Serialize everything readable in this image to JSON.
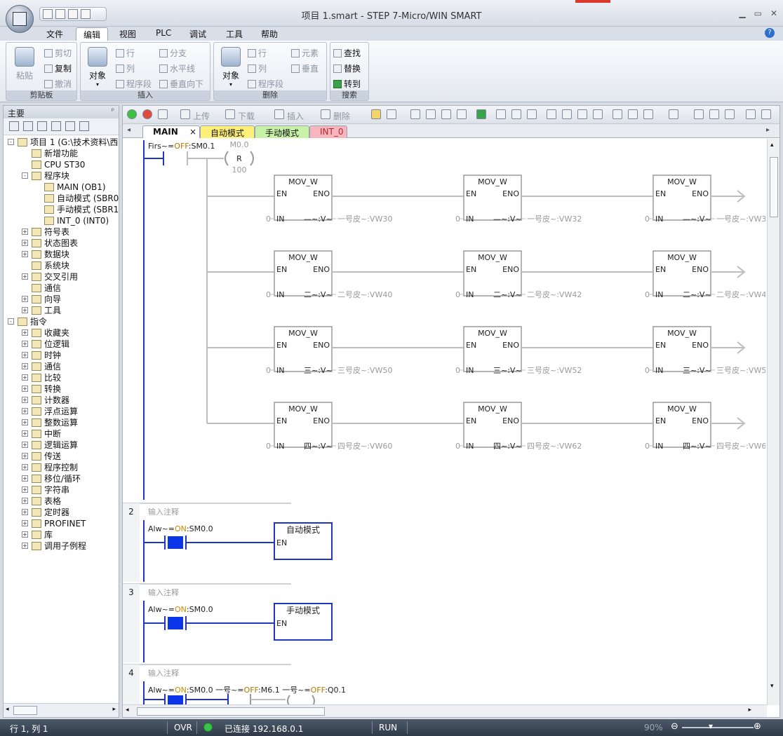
{
  "window": {
    "title": "项目 1.smart - STEP 7-Micro/WIN SMART"
  },
  "menu": [
    "文件",
    "编辑",
    "视图",
    "PLC",
    "调试",
    "工具",
    "帮助"
  ],
  "ribbon": {
    "clipboard": {
      "paste": "粘贴",
      "cut": "剪切",
      "copy": "复制",
      "undo": "撤消",
      "caption": "剪贴板"
    },
    "insert": {
      "object": "对象",
      "row": "行",
      "column": "列",
      "segment": "程序段",
      "branch": "分支",
      "horizontal": "水平线",
      "vertical_down": "垂直向下",
      "caption": "插入"
    },
    "delete": {
      "object": "对象",
      "row": "行",
      "column": "列",
      "segment": "程序段",
      "element": "元素",
      "vertical": "垂直",
      "caption": "删除"
    },
    "search": {
      "find": "查找",
      "replace": "替换",
      "goto": "转到",
      "caption": "搜索"
    }
  },
  "left_pane": {
    "title": "主要",
    "tree": [
      {
        "label": "项目 1 (G:\\技术资料\\西",
        "level": 0,
        "exp": "-"
      },
      {
        "label": "新增功能",
        "level": 1,
        "exp": ""
      },
      {
        "label": "CPU ST30",
        "level": 1,
        "exp": ""
      },
      {
        "label": "程序块",
        "level": 1,
        "exp": "-"
      },
      {
        "label": "MAIN (OB1)",
        "level": 2,
        "exp": ""
      },
      {
        "label": "自动模式 (SBR0",
        "level": 2,
        "exp": ""
      },
      {
        "label": "手动模式 (SBR1",
        "level": 2,
        "exp": ""
      },
      {
        "label": "INT_0 (INT0)",
        "level": 2,
        "exp": ""
      },
      {
        "label": "符号表",
        "level": 1,
        "exp": "+"
      },
      {
        "label": "状态图表",
        "level": 1,
        "exp": "+"
      },
      {
        "label": "数据块",
        "level": 1,
        "exp": "+"
      },
      {
        "label": "系统块",
        "level": 1,
        "exp": ""
      },
      {
        "label": "交叉引用",
        "level": 1,
        "exp": "+"
      },
      {
        "label": "通信",
        "level": 1,
        "exp": ""
      },
      {
        "label": "向导",
        "level": 1,
        "exp": "+"
      },
      {
        "label": "工具",
        "level": 1,
        "exp": "+"
      },
      {
        "label": "指令",
        "level": 0,
        "exp": "-"
      },
      {
        "label": "收藏夹",
        "level": 1,
        "exp": "+"
      },
      {
        "label": "位逻辑",
        "level": 1,
        "exp": "+"
      },
      {
        "label": "时钟",
        "level": 1,
        "exp": "+"
      },
      {
        "label": "通信",
        "level": 1,
        "exp": "+"
      },
      {
        "label": "比较",
        "level": 1,
        "exp": "+"
      },
      {
        "label": "转换",
        "level": 1,
        "exp": "+"
      },
      {
        "label": "计数器",
        "level": 1,
        "exp": "+"
      },
      {
        "label": "浮点运算",
        "level": 1,
        "exp": "+"
      },
      {
        "label": "整数运算",
        "level": 1,
        "exp": "+"
      },
      {
        "label": "中断",
        "level": 1,
        "exp": "+"
      },
      {
        "label": "逻辑运算",
        "level": 1,
        "exp": "+"
      },
      {
        "label": "传送",
        "level": 1,
        "exp": "+"
      },
      {
        "label": "程序控制",
        "level": 1,
        "exp": "+"
      },
      {
        "label": "移位/循环",
        "level": 1,
        "exp": "+"
      },
      {
        "label": "字符串",
        "level": 1,
        "exp": "+"
      },
      {
        "label": "表格",
        "level": 1,
        "exp": "+"
      },
      {
        "label": "定时器",
        "level": 1,
        "exp": "+"
      },
      {
        "label": "PROFINET",
        "level": 1,
        "exp": "+"
      },
      {
        "label": "库",
        "level": 1,
        "exp": "+"
      },
      {
        "label": "调用子例程",
        "level": 1,
        "exp": "+"
      }
    ]
  },
  "editor_toolbar": {
    "upload": "上传",
    "download": "下载",
    "insert": "插入",
    "delete": "删除"
  },
  "tabs": [
    {
      "label": "MAIN",
      "color": "#ffffff",
      "close": "×"
    },
    {
      "label": "自动模式",
      "color": "#fff07a"
    },
    {
      "label": "手动模式",
      "color": "#c7f2a8"
    },
    {
      "label": "INT_0",
      "color": "#f7b6bd"
    }
  ],
  "ladder": {
    "network1": {
      "contact_label": "Firs~=",
      "contact_state": "OFF",
      "contact_addr": ":SM0.1",
      "coil_addr": "M0.0",
      "coil_type": "R",
      "coil_count": "100",
      "rows": [
        {
          "inputs": [
            "0",
            "0",
            "0"
          ],
          "out_prefix": [
            "—",
            "—",
            "—"
          ],
          "outputs": [
            "一号皮~:VW30",
            "一号皮~:VW32",
            "一号皮~:VW3"
          ]
        },
        {
          "inputs": [
            "0",
            "0",
            "0"
          ],
          "out_prefix": [
            "二",
            "二",
            "二"
          ],
          "outputs": [
            "二号皮~:VW40",
            "二号皮~:VW42",
            "二号皮~:VW4"
          ]
        },
        {
          "inputs": [
            "0",
            "0",
            "0"
          ],
          "out_prefix": [
            "三",
            "三",
            "三"
          ],
          "outputs": [
            "三号皮~:VW50",
            "三号皮~:VW52",
            "三号皮~:VW5"
          ]
        },
        {
          "inputs": [
            "0",
            "0",
            "0"
          ],
          "out_prefix": [
            "四",
            "四",
            "四"
          ],
          "outputs": [
            "四号皮~:VW60",
            "四号皮~:VW62",
            "四号皮~:VW6"
          ]
        }
      ],
      "box": {
        "name": "MOV_W",
        "en": "EN",
        "eno": "ENO",
        "in": "IN",
        "out_suffix": "~:V~"
      }
    },
    "network2": {
      "number": "2",
      "comment": "输入注释",
      "contact_label": "Alw~=",
      "contact_state": "ON",
      "contact_addr": ":SM0.0",
      "box": "自动模式",
      "en": "EN"
    },
    "network3": {
      "number": "3",
      "comment": "输入注释",
      "contact_label": "Alw~=",
      "contact_state": "ON",
      "contact_addr": ":SM0.0",
      "box": "手动模式",
      "en": "EN"
    },
    "network4": {
      "number": "4",
      "comment": "输入注释",
      "contact_label": "Alw~=",
      "contact_state": "ON",
      "contact_addr": ":SM0.0",
      "contact2_label": "一号~=",
      "contact2_state": "OFF",
      "contact2_addr": ":M6.1",
      "coil_label": "一号~=",
      "coil_state": "OFF",
      "coil_addr": ":Q0.1"
    }
  },
  "status": {
    "position": "行 1, 列 1",
    "mode": "OVR",
    "connection": "已连接 192.168.0.1",
    "run": "RUN",
    "zoom": "90%"
  },
  "colors": {
    "state_off": "#b27a00",
    "state_on": "#c98a00",
    "wire_on": "#1f35c4",
    "contact_fill": "#0b35e8"
  }
}
